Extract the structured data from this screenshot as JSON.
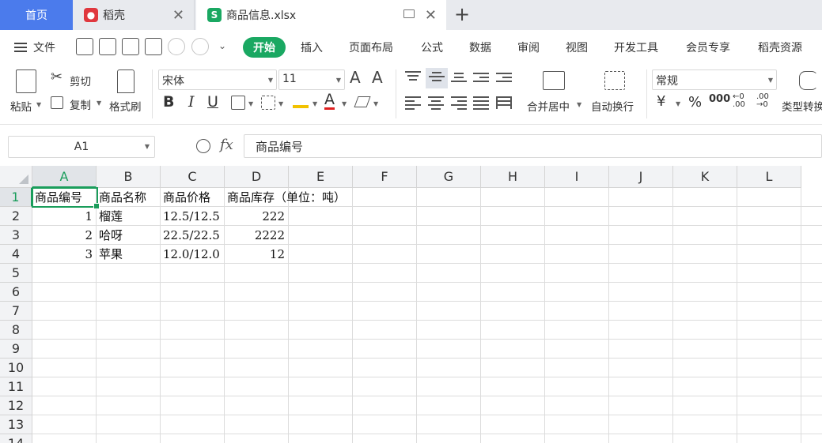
{
  "tabs": {
    "home": "首页",
    "docer": "稻壳",
    "file": "商品信息.xlsx"
  },
  "menu": {
    "file": "文件",
    "items": [
      "开始",
      "插入",
      "页面布局",
      "公式",
      "数据",
      "审阅",
      "视图",
      "开发工具",
      "会员专享",
      "稻壳资源"
    ]
  },
  "ribbon": {
    "paste": "粘贴",
    "cut": "剪切",
    "copy": "复制",
    "format_painter": "格式刷",
    "font_name": "宋体",
    "font_size": "11",
    "bold": "B",
    "italic": "I",
    "underline": "U",
    "merge_center": "合并居中",
    "wrap_text": "自动换行",
    "number_format": "常规",
    "type_convert": "类型转换"
  },
  "formula_bar": {
    "name_box": "A1",
    "fx": "fx",
    "formula": "商品编号"
  },
  "sheet": {
    "columns": [
      "A",
      "B",
      "C",
      "D",
      "E",
      "F",
      "G",
      "H",
      "I",
      "J",
      "K",
      "L"
    ],
    "rows": [
      "1",
      "2",
      "3",
      "4",
      "5",
      "6",
      "7",
      "8",
      "9",
      "10",
      "11",
      "12",
      "13",
      "14"
    ],
    "cells": {
      "A1": "商品编号",
      "B1": "商品名称",
      "C1": "商品价格",
      "D1": "商品库存（单位：吨）",
      "A2": "1",
      "B2": "榴莲",
      "C2": "12.5/12.5",
      "D2": "222",
      "A3": "2",
      "B3": "哈呀",
      "C3": "22.5/22.5",
      "D3": "2222",
      "A4": "3",
      "B4": "苹果",
      "C4": "12.0/12.0",
      "D4": "12"
    }
  },
  "colors": {
    "accent_green": "#1aa862",
    "home_tab_blue": "#4b7bec"
  }
}
